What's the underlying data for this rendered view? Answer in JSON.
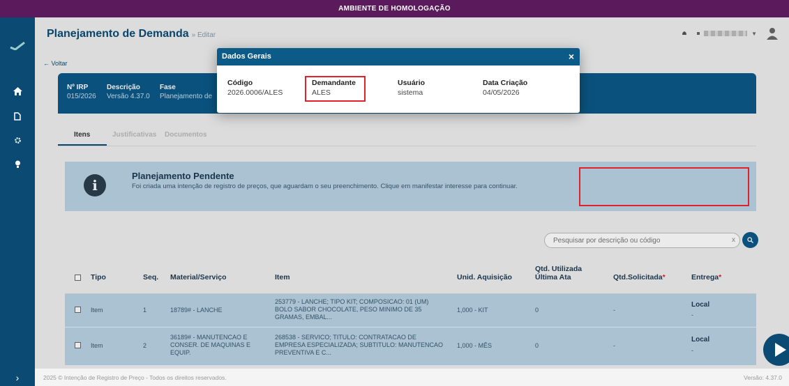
{
  "banner": "AMBIENTE DE HOMOLOGAÇÃO",
  "header": {
    "title": "Planejamento de Demanda",
    "subtitle": "» Editar"
  },
  "back_label": "← Voltar",
  "info": {
    "irp_label": "Nº IRP",
    "irp_value": "015/2026",
    "desc_label": "Descrição",
    "desc_value": "Versão 4.37.0",
    "fase_label": "Fase",
    "fase_value": "Planejamento de"
  },
  "tabs": [
    "Itens",
    "Justificativas",
    "Documentos"
  ],
  "alert": {
    "title": "Planejamento Pendente",
    "text": "Foi criada uma intenção de registro de preços, que aguardam o seu preenchimento. Clique em manifestar interesse para continuar."
  },
  "search": {
    "placeholder": "Pesquisar por descrição ou código",
    "clear": "x"
  },
  "table": {
    "headers": {
      "tipo": "Tipo",
      "seq": "Seq.",
      "material": "Material/Serviço",
      "item": "Item",
      "unid": "Unid. Aquisição",
      "qtd_util": "Qtd. Utilizada Última Ata",
      "qtd_sol": "Qtd.Solicitada",
      "entrega": "Entrega",
      "required_mark": "*"
    },
    "rows": [
      {
        "tipo": "Item",
        "seq": "1",
        "material": "18789# - LANCHE",
        "item": "253779 - LANCHE; TIPO KIT; COMPOSICAO: 01 (UM) BOLO SABOR CHOCOLATE, PESO MINIMO DE 35 GRAMAS, EMBAL...",
        "unid": "1,000 - KIT",
        "qtd_util": "0",
        "qtd_sol": "-",
        "entrega": "Local",
        "entrega_sub": "-"
      },
      {
        "tipo": "Item",
        "seq": "2",
        "material": "36189# - MANUTENCAO E CONSER. DE MAQUINAS E EQUIP.",
        "item": "268538 - SERVICO; TITULO: CONTRATACAO DE EMPRESA ESPECIALIZADA; SUBTITULO: MANUTENCAO PREVENTIVA E C...",
        "unid": "1,000 - MÊS",
        "qtd_util": "0",
        "qtd_sol": "-",
        "entrega": "Local",
        "entrega_sub": "-"
      }
    ]
  },
  "footer": {
    "copyright": "2025 © Intenção de Registro de Preço - Todos os direitos reservados.",
    "version": "Versão: 4.37.0"
  },
  "modal": {
    "title": "Dados Gerais",
    "close": "×",
    "fields": [
      {
        "label": "Código",
        "value": "2026.0006/ALES"
      },
      {
        "label": "Demandante",
        "value": "ALES"
      },
      {
        "label": "Usuário",
        "value": "sistema"
      },
      {
        "label": "Data Criação",
        "value": "04/05/2026"
      }
    ]
  },
  "colors": {
    "primary": "#0b4b73",
    "banner": "#5a1a5c",
    "alert_bg": "#b9d3e3",
    "highlight": "#e0202a"
  }
}
